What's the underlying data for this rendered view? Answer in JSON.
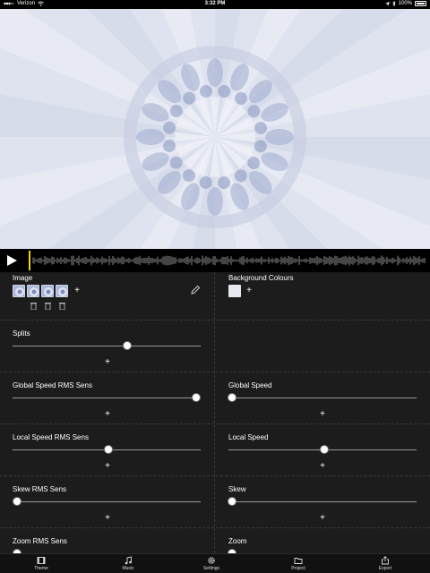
{
  "status_bar": {
    "carrier": "Verizon",
    "time": "3:32 PM",
    "battery": "100%"
  },
  "preview": {
    "theme_colors": [
      "#dfe3ef",
      "#c4cbe0",
      "#9fabcd",
      "#7d8dbc"
    ],
    "petal_count": 16
  },
  "transport": {
    "playhead_position": 0.02
  },
  "image_section": {
    "label": "Image",
    "add_label": "+",
    "thumbnail_count": 3
  },
  "background_section": {
    "label": "Background Colours",
    "add_label": "+",
    "swatch_color": "#e8e8f0"
  },
  "sliders": {
    "splits": {
      "label": "Splits",
      "value": 0.61,
      "add_label": "+"
    },
    "global_speed_rms": {
      "label": "Global Speed RMS Sens",
      "value": 1.0,
      "add_label": "+"
    },
    "global_speed": {
      "label": "Global Speed",
      "value": 0.0,
      "add_label": "+"
    },
    "local_speed_rms": {
      "label": "Local Speed RMS Sens",
      "value": 0.5,
      "add_label": "+"
    },
    "local_speed": {
      "label": "Local Speed",
      "value": 0.5,
      "add_label": "+"
    },
    "skew_rms": {
      "label": "Skew RMS Sens",
      "value": 0.0,
      "add_label": "+"
    },
    "skew": {
      "label": "Skew",
      "value": 0.0,
      "add_label": "+"
    },
    "zoom_rms": {
      "label": "Zoom RMS Sens"
    },
    "zoom": {
      "label": "Zoom"
    }
  },
  "tabs": [
    {
      "label": "Theme",
      "icon": "film-icon"
    },
    {
      "label": "Music",
      "icon": "music-note-icon"
    },
    {
      "label": "Settings",
      "icon": "gear-icon"
    },
    {
      "label": "Project",
      "icon": "folder-icon"
    },
    {
      "label": "Export",
      "icon": "share-icon"
    }
  ]
}
